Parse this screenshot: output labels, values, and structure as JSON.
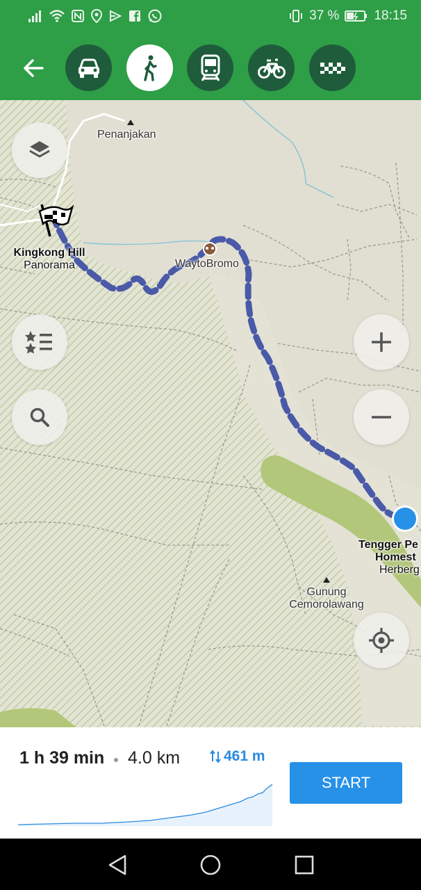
{
  "status_bar": {
    "battery": "37 %",
    "time": "18:15",
    "icons": [
      "signal-icon",
      "wifi-icon",
      "nfc-icon",
      "location-icon",
      "send-icon",
      "facebook-icon",
      "whatsapp-icon",
      "vibrate-icon",
      "battery-icon"
    ]
  },
  "route_bar": {
    "modes": [
      {
        "name": "car",
        "icon": "car-icon",
        "active": false
      },
      {
        "name": "pedestrian",
        "icon": "walk-icon",
        "active": true
      },
      {
        "name": "transit",
        "icon": "train-icon",
        "active": false
      },
      {
        "name": "bicycle",
        "icon": "bicycle-icon",
        "active": false
      },
      {
        "name": "taxi",
        "icon": "taxi-icon",
        "active": false
      }
    ]
  },
  "map": {
    "labels": {
      "penanjakan": "Penanjakan",
      "kingkong_line1": "Kingkong Hill",
      "kingkong_line2": "Panorama",
      "waytobromo": "WaytoBromo",
      "tengger_line1": "Tengger Pe",
      "tengger_line2": "Homest",
      "tengger_line3": "Herberg",
      "gunung_line1": "Gunung",
      "gunung_line2": "Cemorolawang"
    },
    "route_color": "#4a5aa8",
    "accent": "#2e9e47"
  },
  "route_summary": {
    "time": "1 h 39 min",
    "distance": "4.0 km",
    "elevation": "461 m",
    "start_label": "START"
  }
}
